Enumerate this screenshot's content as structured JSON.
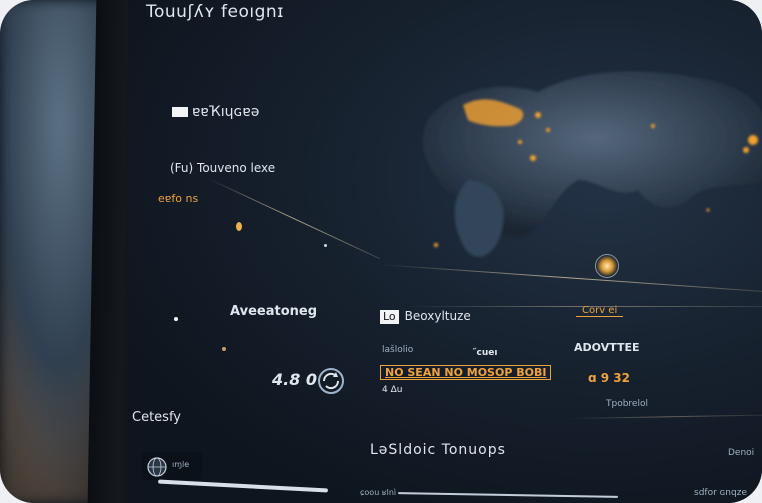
{
  "screen": {
    "title": "Touuʃʎʏ feoıgnɪ",
    "subtitle": "ɐɐҠıɥɢɐǝ",
    "status_line": "(Fu) Touveno lexe",
    "status_value": "eɐfo ns",
    "mid_label": "Aveeatoneg",
    "mid_box": "Lo",
    "mid_heading": "Beoxyltuze",
    "mid_row_1": "lašlolio",
    "mid_row_2": "˝cueı",
    "mid_amber_bar": "NO SEAN NO MOSOP BOBI",
    "mid_sub": "4 Δu",
    "count": "4.8 0",
    "side_label": "Cetesfy",
    "right_heading": "ADOVTTEE",
    "right_value": "ɑ 9 32",
    "right_tag": "Corv ei",
    "right_small": "Tpobrelol",
    "bottom_title": "LəSldoic Tonuops",
    "bottom_left": "ıɱle",
    "bottom_right": "Denoi",
    "bottom_right_2": "sdfor ɢnqze",
    "bottom_mid": "ɕoou ʁlnì"
  },
  "colors": {
    "accent_amber": "#f0a23a",
    "text_light": "#dfe6ee",
    "screen_bg": "#141d28"
  },
  "icons": {
    "globe": "globe-icon",
    "refresh": "refresh-icon",
    "location": "location-dot-icon"
  }
}
